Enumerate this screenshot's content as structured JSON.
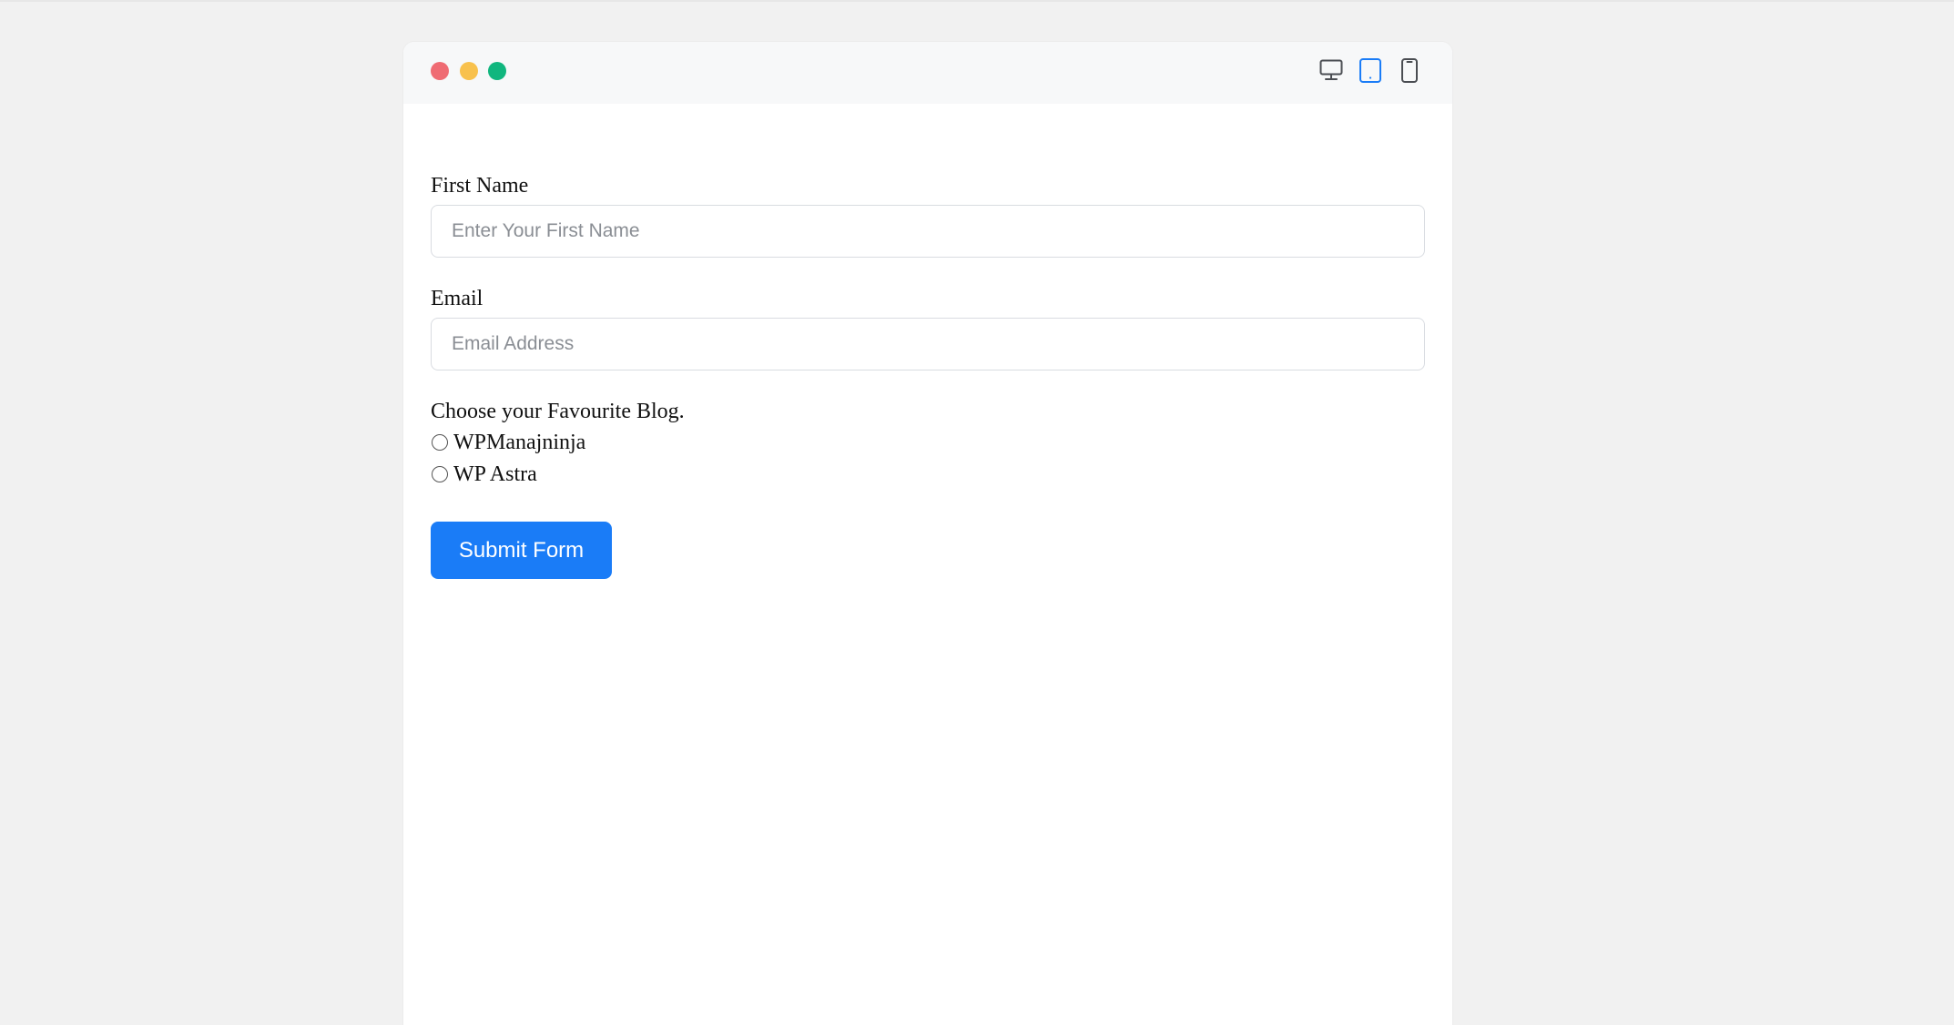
{
  "window": {
    "controls": [
      "close",
      "minimize",
      "maximize"
    ],
    "device_toggle": {
      "options": [
        "desktop-icon",
        "tablet-icon",
        "mobile-icon"
      ],
      "active": "tablet"
    }
  },
  "form": {
    "first_name": {
      "label": "First Name",
      "placeholder": "Enter Your First Name",
      "value": ""
    },
    "email": {
      "label": "Email",
      "placeholder": "Email Address",
      "value": ""
    },
    "blog_choice": {
      "label": "Choose your Favourite Blog.",
      "options": [
        "WPManajninja",
        "WP Astra"
      ],
      "selected": null
    },
    "submit_label": "Submit Form"
  },
  "colors": {
    "page_background": "#f1f1f1",
    "window_bar": "#f7f8f9",
    "dot_red": "#ef6b73",
    "dot_yellow": "#f8c14d",
    "dot_green": "#10b67e",
    "accent": "#1a7cf7",
    "device_icon": "#4a4d52"
  }
}
